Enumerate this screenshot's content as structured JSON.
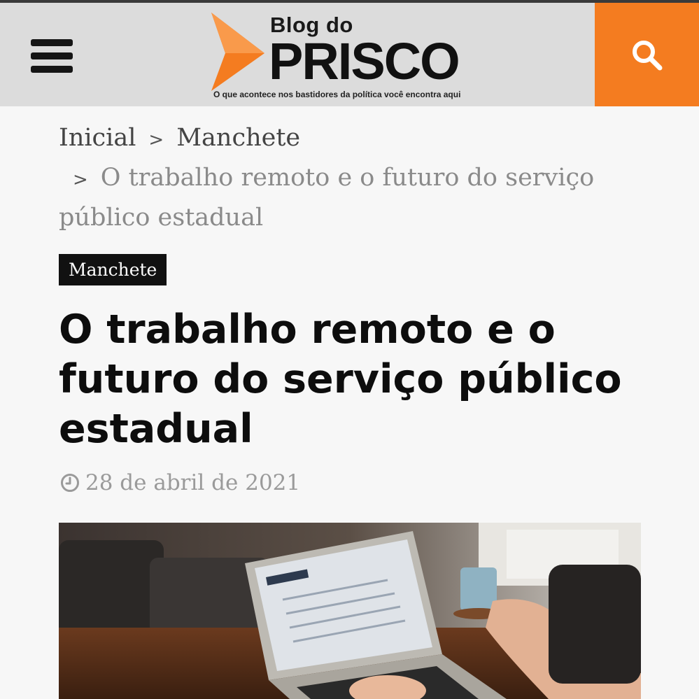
{
  "header": {
    "logo_blog": "Blog do",
    "logo_name": "PRISCO",
    "tagline": "O que acontece nos bastidores da política você encontra aqui",
    "menu_icon": "hamburger-menu-icon",
    "search_icon": "search-icon"
  },
  "breadcrumb": {
    "home": "Inicial",
    "category": "Manchete",
    "current": "O trabalho remoto e o futuro do serviço público estadual",
    "separator": ">"
  },
  "article": {
    "category_badge": "Manchete",
    "title": "O trabalho remoto e o futuro do serviço público estadual",
    "date": "28 de abril de 2021",
    "date_icon": "clock-icon"
  },
  "colors": {
    "accent": "#f47c20",
    "header_bg": "#dcdcdc",
    "badge_bg": "#111111"
  }
}
